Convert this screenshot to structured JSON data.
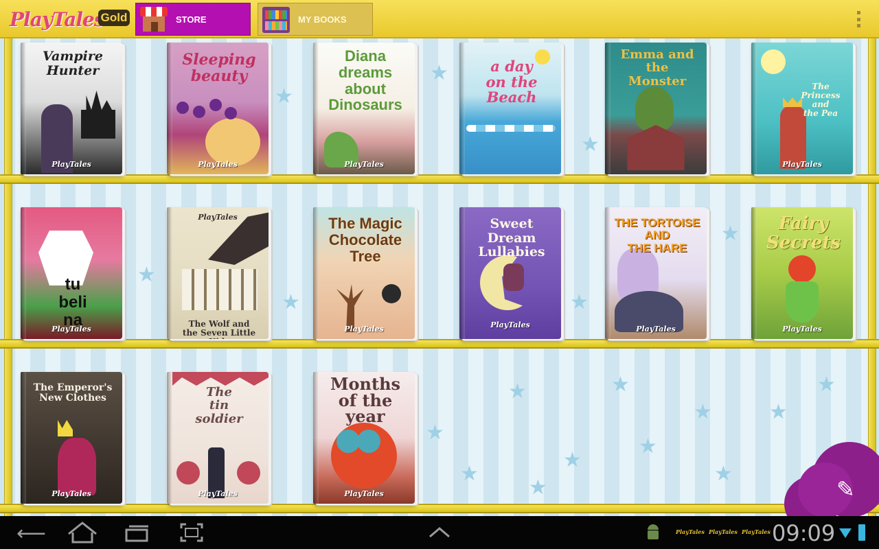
{
  "app": {
    "logo_text": "PlayTales",
    "gold_label": "Gold",
    "colors": {
      "topbar": "#f2d845",
      "store_tab": "#b40fb0",
      "shelf": "#e6d22a",
      "cloud": "#8c1f8a"
    }
  },
  "tabs": [
    {
      "label": "STORE",
      "icon": "store-icon",
      "active": true
    },
    {
      "label": "MY BOOKS",
      "icon": "bookshelf-icon",
      "active": false
    }
  ],
  "shelves": [
    {
      "books": [
        {
          "title": "Vampire\nHunter",
          "brand": "PlayTales"
        },
        {
          "title": "Sleeping\nbeauty",
          "brand": "PlayTales"
        },
        {
          "title": "Diana\ndreams about\nDinosaurs",
          "brand": "PlayTales"
        },
        {
          "title": "a day\non the Beach",
          "brand": ""
        },
        {
          "title": "Emma and the\nMonster",
          "brand": ""
        },
        {
          "title": "The Princess\nand\nthe Pea",
          "brand": "PlayTales"
        }
      ]
    },
    {
      "books": [
        {
          "title": "tu\nbeli\nna",
          "brand": "PlayTales"
        },
        {
          "title": "The Wolf and\nthe Seven Little Kids",
          "brand": "PlayTales"
        },
        {
          "title": "The Magic\nChocolate\nTree",
          "brand": "PlayTales"
        },
        {
          "title": "Sweet Dream\nLullabies",
          "brand": "PlayTales"
        },
        {
          "title": "THE TORTOISE\nAND\nTHE HARE",
          "brand": "PlayTales"
        },
        {
          "title": "Fairy\nSecrets",
          "brand": "PlayTales"
        }
      ]
    },
    {
      "books": [
        {
          "title": "The Emperor's\nNew Clothes",
          "brand": "PlayTales"
        },
        {
          "title": "The\ntin\nsoldier",
          "brand": "PlayTales"
        },
        {
          "title": "Months\nof the\nyear",
          "brand": "PlayTales"
        }
      ]
    }
  ],
  "fab": {
    "icon": "pencil-icon"
  },
  "system_bar": {
    "nav": [
      "back-icon",
      "home-icon",
      "recent-apps-icon",
      "screenshot-icon",
      "chevron-up-icon"
    ],
    "notifications": [
      "PlayTales",
      "PlayTales",
      "PlayTales"
    ],
    "time": "09:09"
  }
}
